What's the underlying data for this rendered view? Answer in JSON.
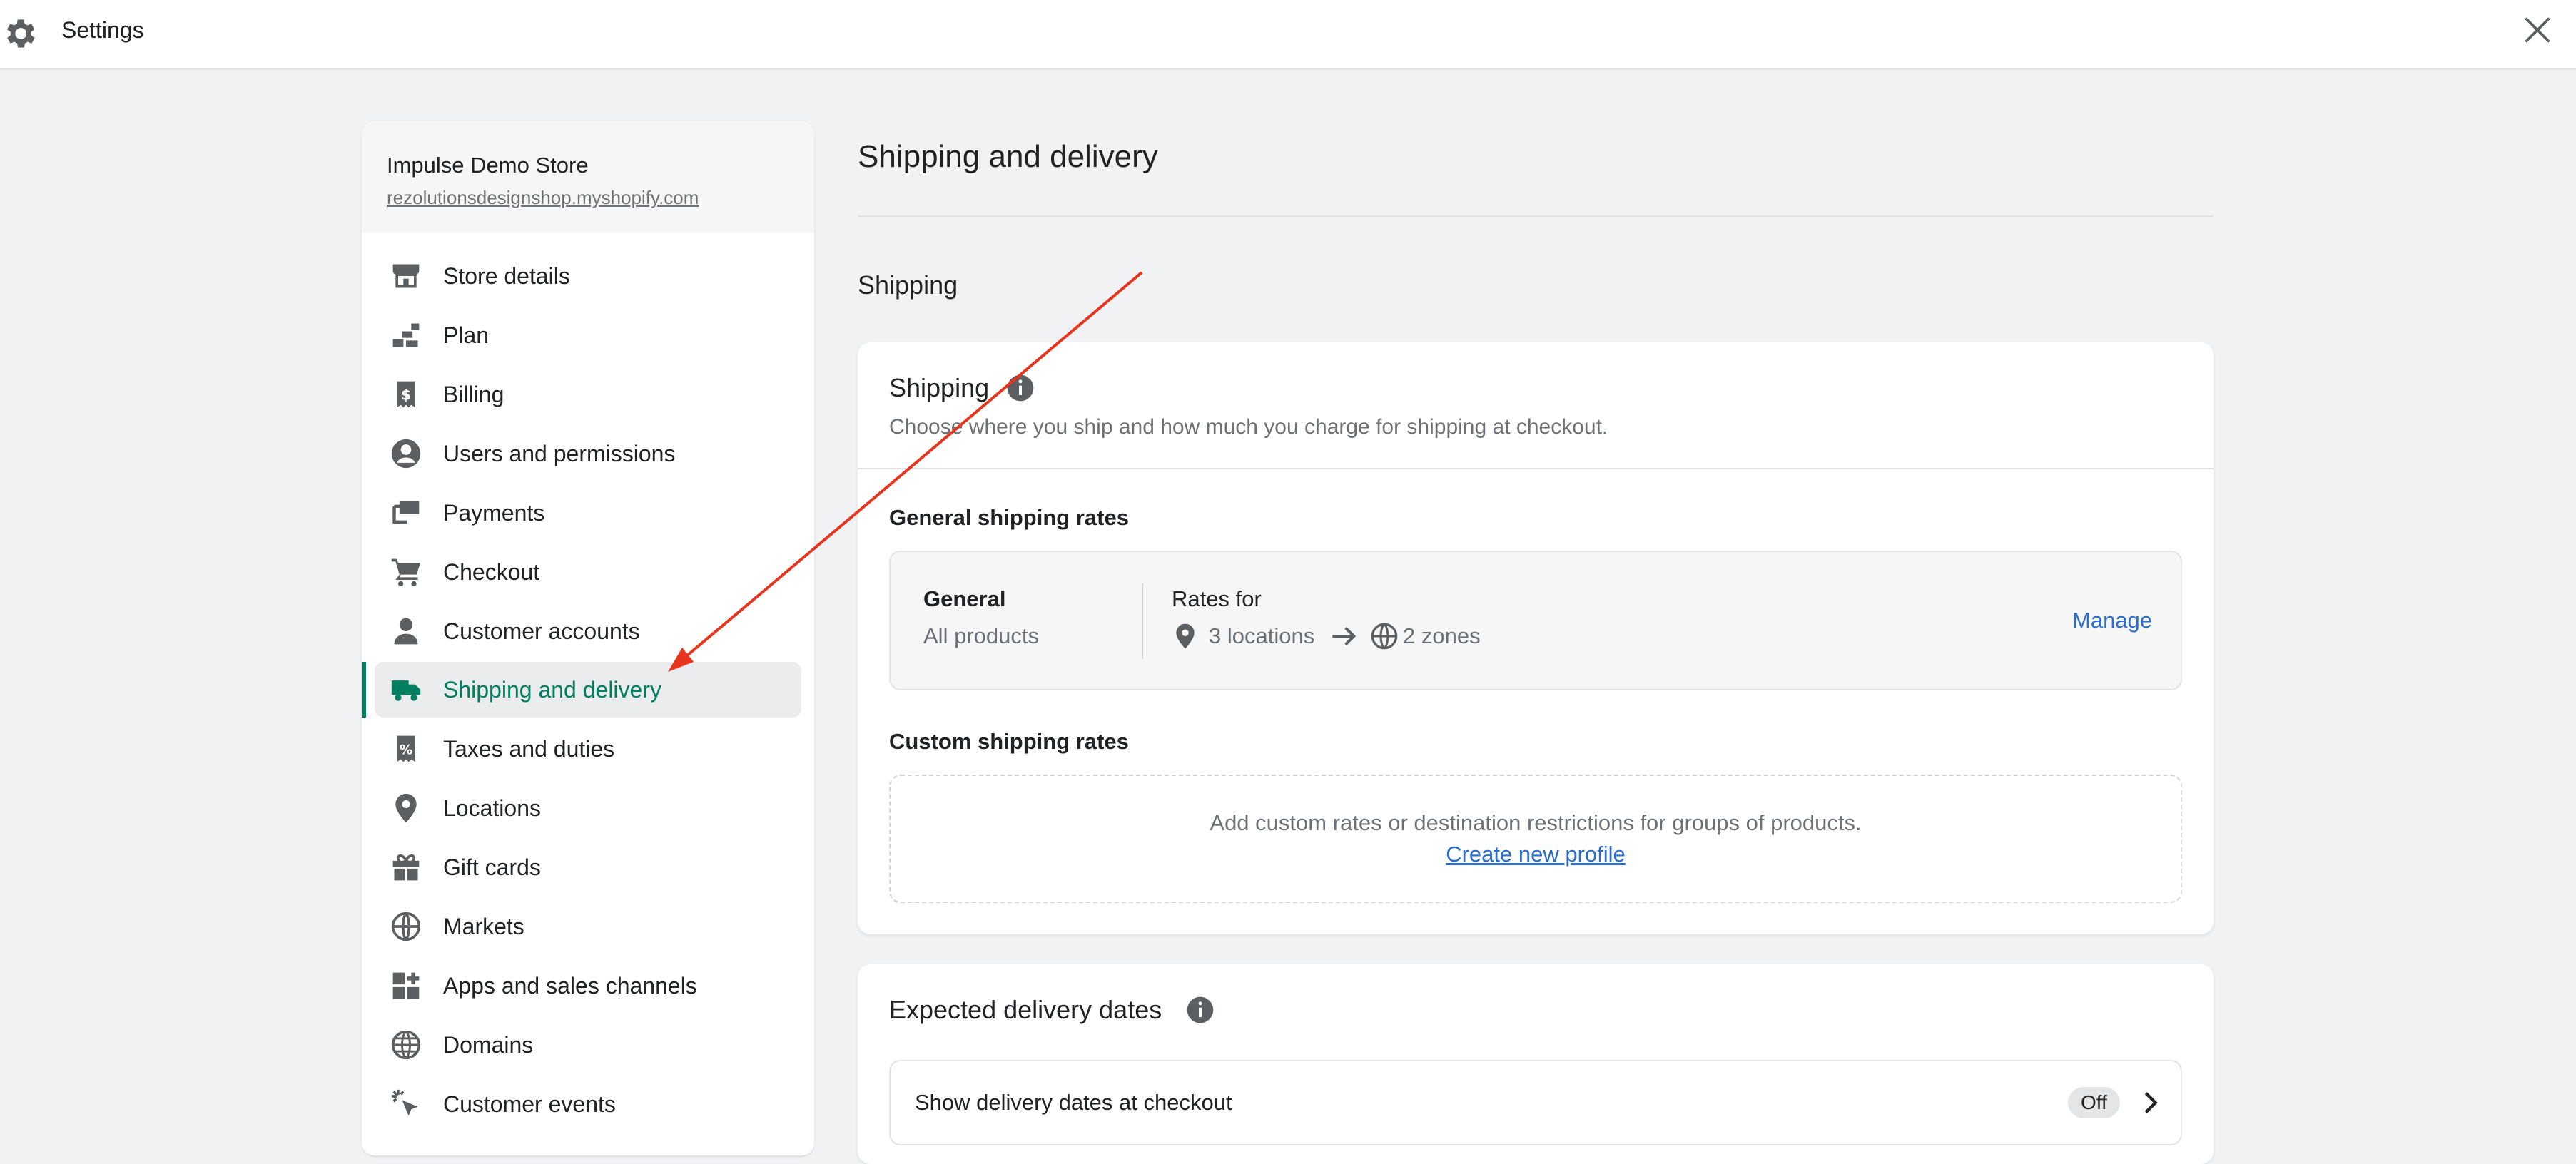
{
  "topbar": {
    "title": "Settings",
    "gear_icon": "gear-icon",
    "close_icon": "close-icon"
  },
  "sidebar": {
    "store_name": "Impulse Demo Store",
    "store_url": "rezolutionsdesignshop.myshopify.com",
    "items": [
      {
        "label": "Store details",
        "icon": "store-icon"
      },
      {
        "label": "Plan",
        "icon": "plan-icon"
      },
      {
        "label": "Billing",
        "icon": "billing-icon"
      },
      {
        "label": "Users and permissions",
        "icon": "user-circle-icon"
      },
      {
        "label": "Payments",
        "icon": "payments-icon"
      },
      {
        "label": "Checkout",
        "icon": "cart-icon"
      },
      {
        "label": "Customer accounts",
        "icon": "person-icon"
      },
      {
        "label": "Shipping and delivery",
        "icon": "truck-icon",
        "active": true
      },
      {
        "label": "Taxes and duties",
        "icon": "tax-receipt-icon"
      },
      {
        "label": "Locations",
        "icon": "location-pin-icon"
      },
      {
        "label": "Gift cards",
        "icon": "gift-icon"
      },
      {
        "label": "Markets",
        "icon": "globe-markets-icon"
      },
      {
        "label": "Apps and sales channels",
        "icon": "apps-icon"
      },
      {
        "label": "Domains",
        "icon": "globe-icon"
      },
      {
        "label": "Customer events",
        "icon": "cursor-click-icon"
      }
    ]
  },
  "main": {
    "page_title": "Shipping and delivery",
    "section_heading": "Shipping",
    "shipping_card": {
      "title": "Shipping",
      "subtitle": "Choose where you ship and how much you charge for shipping at checkout.",
      "general_heading": "General shipping rates",
      "general_name": "General",
      "general_scope": "All products",
      "rates_for": "Rates for",
      "locations": "3 locations",
      "zones": "2 zones",
      "manage": "Manage",
      "custom_heading": "Custom shipping rates",
      "custom_text": "Add custom rates or destination restrictions for groups of products.",
      "custom_link": "Create new profile"
    },
    "delivery_card": {
      "title": "Expected delivery dates",
      "row_label": "Show delivery dates at checkout",
      "status": "Off"
    }
  },
  "colors": {
    "accent": "#008060",
    "link": "#2c6ecb",
    "annotation": "#e8341c"
  }
}
